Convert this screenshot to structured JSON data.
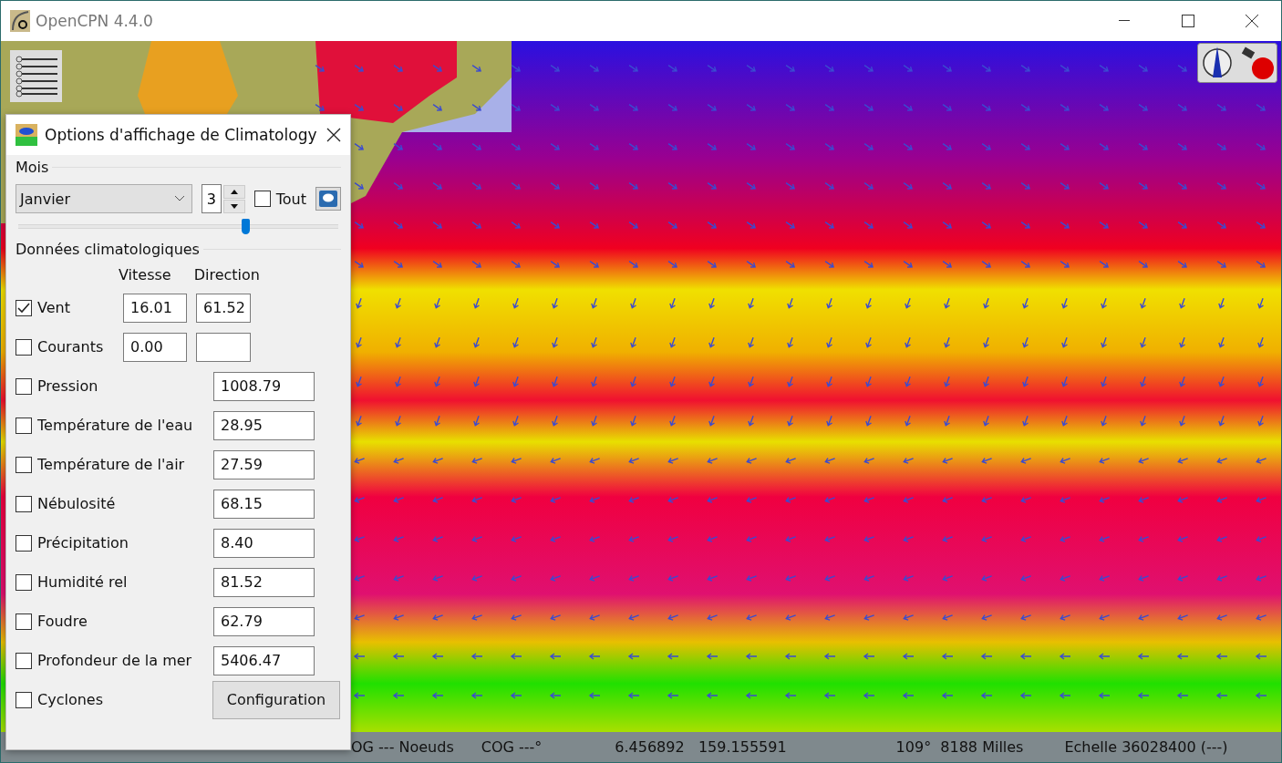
{
  "window": {
    "title": "OpenCPN 4.4.0"
  },
  "dialog": {
    "title": "Options d'affichage de Climatology",
    "month_section": {
      "label": "Mois",
      "month": "Janvier",
      "day": "3",
      "all": {
        "label": "Tout",
        "checked": false
      },
      "level": 0.71
    },
    "data_section": {
      "label": "Données climatologiques",
      "columns": [
        "Vitesse",
        "Direction"
      ],
      "rows": [
        {
          "kind": "pair",
          "label": "Vent",
          "checked": true,
          "speed": "16.01",
          "direction": "61.52"
        },
        {
          "kind": "pair",
          "label": "Courants",
          "checked": false,
          "speed": "0.00"
        },
        {
          "kind": "single",
          "label": "Pression",
          "checked": false,
          "value": "1008.79"
        },
        {
          "kind": "single",
          "label": "Température de l'eau",
          "checked": false,
          "value": "28.95"
        },
        {
          "kind": "single",
          "label": "Température de l'air",
          "checked": false,
          "value": "27.59"
        },
        {
          "kind": "single",
          "label": "Nébulosité",
          "checked": false,
          "value": "68.15"
        },
        {
          "kind": "single",
          "label": "Précipitation",
          "checked": false,
          "value": "8.40"
        },
        {
          "kind": "single",
          "label": "Humidité rel",
          "checked": false,
          "value": "81.52"
        },
        {
          "kind": "single",
          "label": "Foudre",
          "checked": false,
          "value": "62.79"
        },
        {
          "kind": "single",
          "label": "Profondeur de la mer",
          "checked": false,
          "value": "5406.47"
        },
        {
          "kind": "button",
          "label": "Cyclones",
          "checked": false,
          "button": "Configuration"
        }
      ]
    }
  },
  "status_bar": [
    "OG --- Noeuds",
    "COG ---°",
    "6.456892   159.155591",
    "109°  8188 Milles",
    "Echelle 36028400 (---)"
  ]
}
